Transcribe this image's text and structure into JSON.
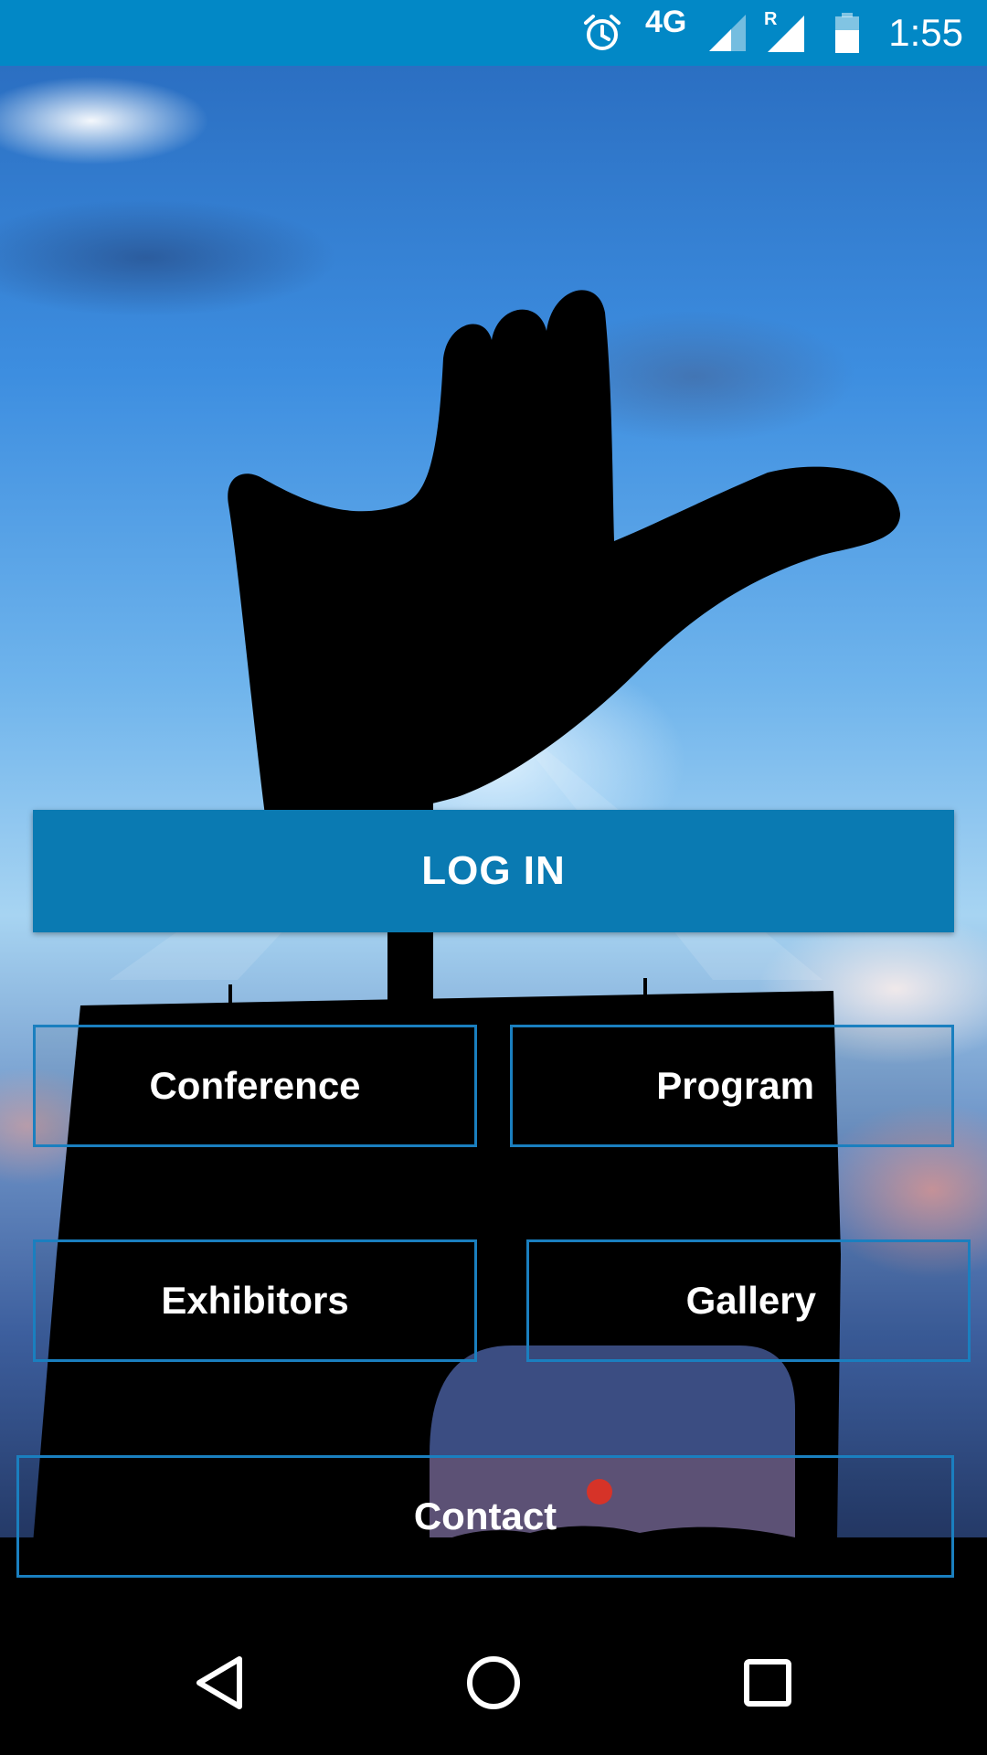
{
  "status_bar": {
    "time": "1:55",
    "network": "4G",
    "roaming_indicator": "R",
    "icons": [
      "alarm-icon",
      "signal-icon",
      "roaming-signal-icon",
      "battery-icon"
    ]
  },
  "buttons": {
    "login": "LOG IN",
    "conference": "Conference",
    "program": "Program",
    "exhibitors": "Exhibitors",
    "gallery": "Gallery",
    "contact": "Contact"
  },
  "nav_bar": {
    "icons": [
      "back-icon",
      "home-icon",
      "recents-icon"
    ]
  },
  "colors": {
    "status_bar": "#0288c6",
    "primary_button": "#0a7ab2",
    "outline": "#1a7fbf"
  }
}
